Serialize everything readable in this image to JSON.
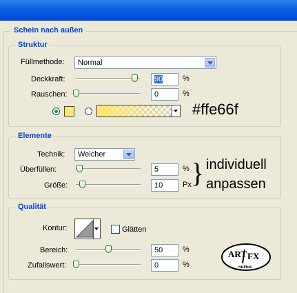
{
  "dialog": {
    "section_title": "Schein nach außen"
  },
  "struktur": {
    "title": "Struktur",
    "fuellmethode_label": "Füllmethode:",
    "fuellmethode_value": "Normal",
    "deckkraft_label": "Deckkraft:",
    "deckkraft_value": "90",
    "deckkraft_level": 0.9,
    "rauschen_label": "Rauschen:",
    "rauschen_value": "0",
    "rauschen_level": 0,
    "percent": "%",
    "solid_color": "#ffe66f",
    "gradient_from": "#ffe66f",
    "color_annotation": "#ffe66f"
  },
  "elemente": {
    "title": "Elemente",
    "technik_label": "Technik:",
    "technik_value": "Weicher",
    "ueberfuellen_label": "Überfüllen:",
    "ueberfuellen_value": "5",
    "ueberfuellen_level": 0.05,
    "groesse_label": "Größe:",
    "groesse_value": "10",
    "groesse_level": 0.1,
    "percent": "%",
    "px": "Px",
    "brace": "}",
    "note_line1": "individuell",
    "note_line2": "anpassen"
  },
  "qualitaet": {
    "title": "Qualität",
    "kontur_label": "Kontur:",
    "glaetten_label": "Glätten",
    "glaetten_checked": false,
    "bereich_label": "Bereich:",
    "bereich_value": "50",
    "bereich_level": 0.5,
    "zufall_label": "Zufallswert:",
    "zufall_value": "0",
    "zufall_level": 0,
    "percent": "%"
  },
  "logo": {
    "line1": "ART",
    "line2": "FX",
    "line3": "nullius"
  }
}
